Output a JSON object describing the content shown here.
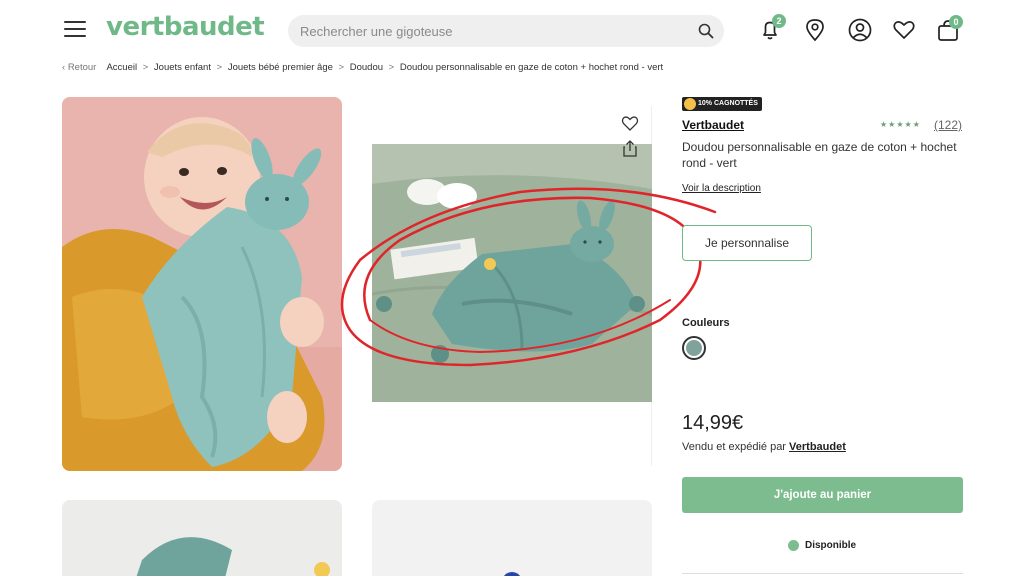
{
  "header": {
    "logo": "vertbaudet",
    "search_placeholder": "Rechercher une gigoteuse",
    "notification_count": "2",
    "cart_count": "0"
  },
  "breadcrumb": {
    "back": "Retour",
    "items": [
      "Accueil",
      "Jouets enfant",
      "Jouets bébé premier âge",
      "Doudou",
      "Doudou personnalisable en gaze de coton + hochet rond - vert"
    ]
  },
  "product": {
    "tag": "10% CAGNOTTÉS",
    "brand": "Vertbaudet",
    "rating_stars": "★★★★★",
    "review_count": "(122)",
    "title": "Doudou personnalisable en gaze de coton + hochet rond - vert",
    "description_link": "Voir la description",
    "personalise_button": "Je personnalise",
    "colors_label": "Couleurs",
    "selected_color": "#7fa39a",
    "price": "14,99€",
    "sold_by_prefix": "Vendu et expédié par",
    "sold_by_seller": "Vertbaudet",
    "add_to_cart": "J'ajoute au panier",
    "availability": "Disponible"
  },
  "colors": {
    "brand_green": "#6fb989",
    "button_green": "#7cbc8e",
    "annotation_red": "#e0252a"
  }
}
